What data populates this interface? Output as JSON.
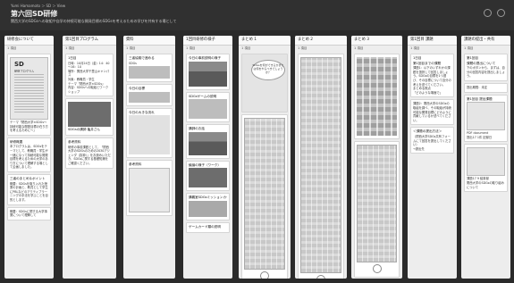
{
  "header": {
    "breadcrumb": "Yumi Hamamoto ＞ SD ＞ View",
    "title": "第六回SD研修",
    "subtitle": "関西大学のSDGsへの取組や自学の持続可能な開発目標のSDGsを考えるための学びを共有する場として"
  },
  "columns": [
    {
      "title": "研修会について",
      "count": "1 項目"
    },
    {
      "title": "第1回目プログラム",
      "count": "1 項目"
    },
    {
      "title": "資料",
      "count": "1 項目"
    },
    {
      "title": "1回目研修の様子",
      "count": "1 項目"
    },
    {
      "title": "まとめ 1",
      "count": "1 項目"
    },
    {
      "title": "まとめ 2",
      "count": "1 項目"
    },
    {
      "title": "まとめ 3",
      "count": "1 項目"
    },
    {
      "title": "第1回目 課題",
      "count": "1 項目"
    },
    {
      "title": "課題の提出・共有",
      "count": "1 項目"
    }
  ],
  "col1": {
    "poster_title": "SD",
    "poster_sub": "研修プログラム",
    "text1": "テーマ「関西大学×SDGs～持続可能な開発目標の在り方を考えるために～」",
    "head2": "研修概要",
    "text2": "本プログラムは、SDGsをテーマとして、教職員・学生が一緒になって持続可能な開発目標を考えるための大学のあり方について理解する場として企画しました。",
    "head3": "三者のまとめ＆ポイント",
    "text3": "概要：SDGsを取り入れた授業の計画と、教員として学生にPBLなどのアクティブラーニングの手法を学ぶことを目的とします。",
    "text4": "概要：SDGsに関する大学事業について理解して"
  },
  "col2": {
    "label": "1日目",
    "lines": [
      "日時：10月24日（金）14：40～16：10",
      "場所：関西大学千里山キャンパス",
      "対象：教職員・学生",
      "テーマ「関西大学×SDGs」",
      "内容：SDGsへの取組とワークショップ"
    ],
    "text2": "SDGsの講師 亀井さん",
    "text3": "参考資料",
    "text4": "研修の事前課題として、「関西大学のSDGsのための2030アジェンダ（抜粋）」をお読みいただき、SDGsに関する基礎知識をご確認ください。"
  },
  "col3": {
    "card1": "三者協働で進める",
    "card1b": "SDGs",
    "card2": "今日の目標",
    "card3": "今日の大きな流れ",
    "card4": "参考資料"
  },
  "col4": {
    "card1": "今日の事前説明の様子",
    "card2": "SDGsゲームの説明",
    "card3": "講師のお話",
    "card4": "議論の様子（ワーク）",
    "card5": "講義室SDGsミッションカード",
    "card6": "ゲームカード類の説明"
  },
  "col5": {
    "bubble": "SDGsを何ができるかまたは何をやるべきでしょうか？"
  },
  "col8": {
    "label": "1日目",
    "text1": "第1回目までの課題",
    "text2": "課題1：以下のいずれかの課題を選択して回答しましょう。SDGsの目標を1つ選び、その目標について自分の考えを述べてください。",
    "text3": "まとめる視点",
    "text4": "「どのような場面で」",
    "text5": "課題2：関西大学のSDGsの取組を調べ、その取組が持続可能な開発目標にどのように貢献しているか述べてください。",
    "text6": "＜課題の提出方法＞",
    "text7": "（関西大学SDGs共有フォームにて回答を提出してください）",
    "text8": "→提出先"
  },
  "col9": {
    "label": "第1回目",
    "text1": "課題の提出について",
    "text2": "下のボタンから、まずは、自分の回答内容を提出しましょう。",
    "text3": "提出期限：未定",
    "text4": "第1回目 提出課題",
    "text5": "PDF document",
    "text6": "提出17 1件 記録日",
    "text7": "課題17 9 議事録",
    "text8": "関西大学のSDGsの取り組みについて"
  }
}
